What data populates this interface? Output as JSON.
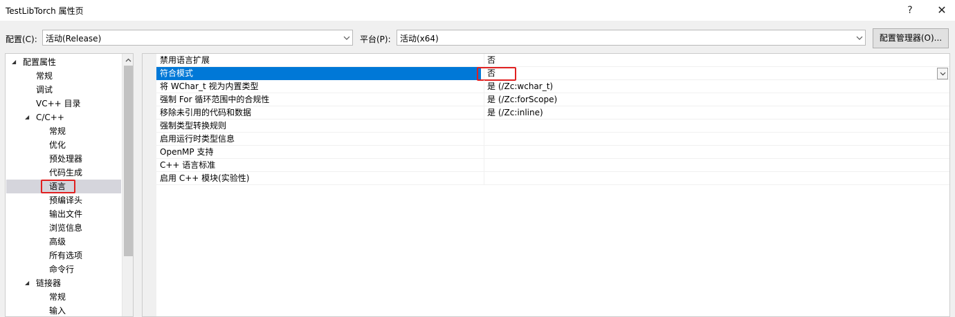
{
  "window": {
    "title": "TestLibTorch 属性页",
    "help_glyph": "?",
    "close_glyph": "✕"
  },
  "toolbar": {
    "config_label": "配置(C):",
    "config_value": "活动(Release)",
    "platform_label": "平台(P):",
    "platform_value": "活动(x64)",
    "manager_button": "配置管理器(O)..."
  },
  "tree": {
    "items": [
      {
        "label": "配置属性",
        "expander": "◢"
      },
      {
        "label": "常规"
      },
      {
        "label": "调试"
      },
      {
        "label": "VC++ 目录"
      },
      {
        "label": "C/C++",
        "expander": "◢"
      },
      {
        "label": "常规"
      },
      {
        "label": "优化"
      },
      {
        "label": "预处理器"
      },
      {
        "label": "代码生成"
      },
      {
        "label": "语言",
        "selected": true
      },
      {
        "label": "预编译头"
      },
      {
        "label": "输出文件"
      },
      {
        "label": "浏览信息"
      },
      {
        "label": "高级"
      },
      {
        "label": "所有选项"
      },
      {
        "label": "命令行"
      },
      {
        "label": "链接器",
        "expander": "◢"
      },
      {
        "label": "常规"
      },
      {
        "label": "输入"
      }
    ]
  },
  "grid": {
    "rows": [
      {
        "name": "禁用语言扩展",
        "value": "否"
      },
      {
        "name": "符合模式",
        "value": "否",
        "selected": true
      },
      {
        "name": "将 WChar_t 视为内置类型",
        "value": "是 (/Zc:wchar_t)"
      },
      {
        "name": "强制 For 循环范围中的合规性",
        "value": "是 (/Zc:forScope)"
      },
      {
        "name": "移除未引用的代码和数据",
        "value": "是 (/Zc:inline)"
      },
      {
        "name": "强制类型转换规则",
        "value": ""
      },
      {
        "name": "启用运行时类型信息",
        "value": ""
      },
      {
        "name": "OpenMP 支持",
        "value": ""
      },
      {
        "name": "C++ 语言标准",
        "value": ""
      },
      {
        "name": "启用 C++ 模块(实验性)",
        "value": ""
      }
    ]
  },
  "colors": {
    "selection": "#0078d7",
    "highlight_box": "#e02020",
    "tree_selection": "#d5d5dc"
  }
}
